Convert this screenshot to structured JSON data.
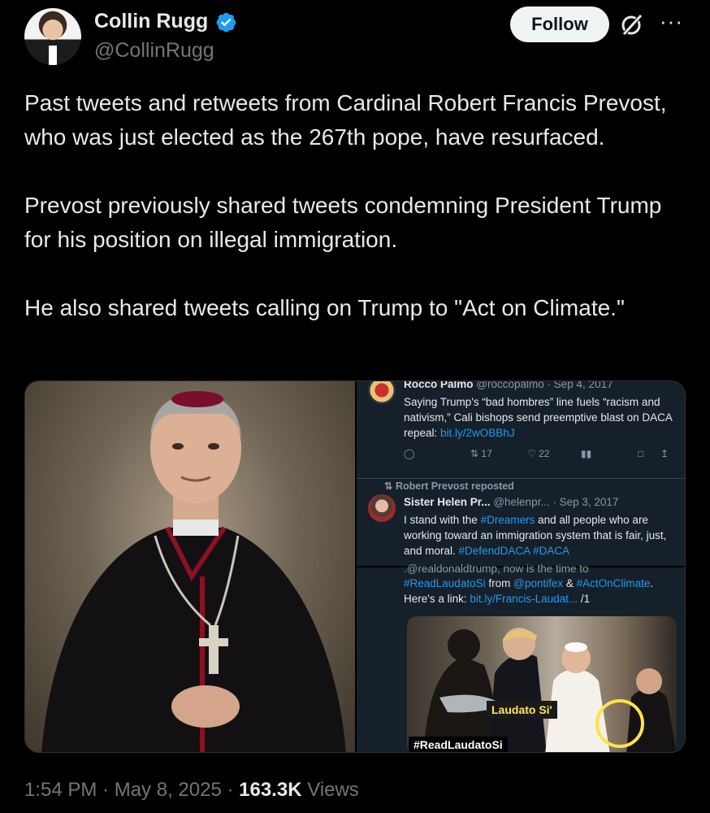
{
  "author": {
    "name": "Collin Rugg",
    "handle": "@CollinRugg"
  },
  "header": {
    "follow_label": "Follow",
    "grok_icon": "grok-icon",
    "more_icon": "more-icon"
  },
  "tweet": {
    "paragraphs": [
      "Past tweets and retweets from Cardinal Robert Francis Prevost, who was just elected as the 267th pope, have resurfaced.",
      "Prevost previously shared tweets condemning President Trump for his position on illegal immigration.",
      "He also shared tweets calling on Trump to \"Act on Climate.\""
    ]
  },
  "embedded": {
    "card1": {
      "name": "Rocco Palmo",
      "meta": "@roccopalmo · Sep 4, 2017",
      "text_before_link": "Saying Trump's “bad hombres” line fuels “racism and nativism,” Cali bishops send preemptive blast on DACA repeal: ",
      "link": "bit.ly/2wOBBhJ",
      "retweets": "17",
      "likes": "22"
    },
    "card2": {
      "repost_line": "Robert Prevost reposted",
      "name": "Sister Helen Pr...",
      "meta": "@helenpr... · Sep 3, 2017",
      "text_1": "I stand with the ",
      "tag_dreamers": "#Dreamers",
      "text_2": " and all people who are working toward an immigration system that is fair, just, and moral. ",
      "tags_end": "#DefendDACA #DACA"
    },
    "card3": {
      "cut_line": ".@realdonaldtrump, now is the time to",
      "tag1": "#ReadLaudatoSi",
      "text_from": " from ",
      "mention": "@pontifex",
      "text_amp": " & ",
      "tag2": "#ActOnClimate",
      "text_end": ".",
      "link_prefix": "Here's a link: ",
      "link": "bit.ly/Francis-Laudat...",
      "link_suffix": " /1",
      "photo_label": "Laudato Si'",
      "photo_tag": "#ReadLaudatoSi"
    }
  },
  "footer": {
    "time": "1:54 PM",
    "date": "May 8, 2025",
    "views_count": "163.3K",
    "views_label": "Views"
  },
  "colors": {
    "background": "#000000",
    "verified": "#1d9bf0",
    "link": "#1d9bf0",
    "embedded_bg": "#15202b"
  }
}
